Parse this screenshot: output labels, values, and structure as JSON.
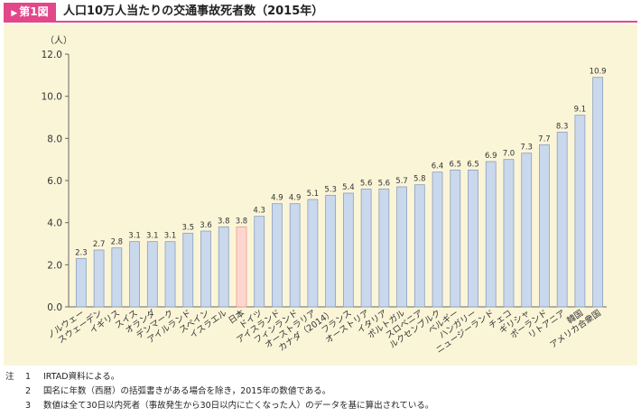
{
  "header": {
    "figure_label": "第1図",
    "title": "人口10万人当たりの交通事故死者数（2015年）"
  },
  "chart_data": {
    "type": "bar",
    "title": "人口10万人当たりの交通事故死者数（2015年）",
    "ylabel": "（人）",
    "xlabel": "",
    "ylim": [
      0,
      12
    ],
    "yticks": [
      0.0,
      2.0,
      4.0,
      6.0,
      8.0,
      10.0,
      12.0
    ],
    "ytick_labels": [
      "0.0",
      "2.0",
      "4.0",
      "6.0",
      "8.0",
      "10.0",
      "12.0"
    ],
    "grid": false,
    "legend": "none",
    "categories": [
      "ノルウェー",
      "スウェーデン",
      "イギリス",
      "スイス",
      "オランダ",
      "デンマーク",
      "アイルランド",
      "スペイン",
      "イスラエル",
      "日本",
      "ドイツ",
      "アイスランド",
      "フィンランド",
      "オーストラリア",
      "カナダ（2014）",
      "フランス",
      "オーストリア",
      "イタリア",
      "ポルトガル",
      "スロベニア",
      "ルクセンブルク",
      "ベルギー",
      "ハンガリー",
      "ニュージーランド",
      "チェコ",
      "ギリシャ",
      "ポーランド",
      "リトアニア",
      "韓国",
      "アメリカ合衆国"
    ],
    "values": [
      2.3,
      2.7,
      2.8,
      3.1,
      3.1,
      3.1,
      3.5,
      3.6,
      3.8,
      3.8,
      4.3,
      4.9,
      4.9,
      5.1,
      5.3,
      5.4,
      5.6,
      5.6,
      5.7,
      5.8,
      6.4,
      6.5,
      6.5,
      6.9,
      7.0,
      7.3,
      7.7,
      8.3,
      9.1,
      10.9
    ],
    "value_labels": [
      "2.3",
      "2.7",
      "2.8",
      "3.1",
      "3.1",
      "3.1",
      "3.5",
      "3.6",
      "3.8",
      "3.8",
      "4.3",
      "4.9",
      "4.9",
      "5.1",
      "5.3",
      "5.4",
      "5.6",
      "5.6",
      "5.7",
      "5.8",
      "6.4",
      "6.5",
      "6.5",
      "6.9",
      "7.0",
      "7.3",
      "7.7",
      "8.3",
      "9.1",
      "10.9"
    ],
    "highlight_index": 9,
    "colors": {
      "bar_fill": "#c9d8ec",
      "bar_stroke": "#8c9fbd",
      "highlight_fill": "#ffd6cf",
      "highlight_stroke": "#e89a8c",
      "panel_bg": "#fbf5d8",
      "accent": "#e2478a"
    }
  },
  "notes": {
    "head": "注",
    "items": [
      {
        "num": "1",
        "text": "IRTAD資料による。"
      },
      {
        "num": "2",
        "text": "国名に年数（西暦）の括弧書きがある場合を除き，2015年の数値である。"
      },
      {
        "num": "3",
        "text": "数値は全て30日以内死者（事故発生から30日以内に亡くなった人）のデータを基に算出されている。"
      }
    ]
  }
}
